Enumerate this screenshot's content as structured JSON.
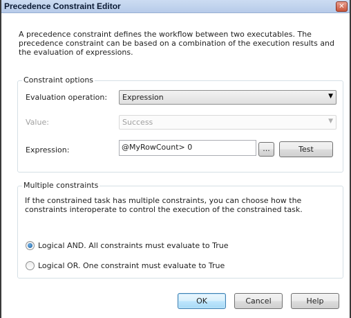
{
  "window": {
    "title": "Precedence Constraint Editor",
    "close_glyph": "✕"
  },
  "intro_text": "A precedence constraint defines the workflow between two executables. The precedence constraint can be based on a combination of the execution results and the evaluation of expressions.",
  "constraint_options": {
    "legend": "Constraint options",
    "evaluation_operation": {
      "label": "Evaluation operation:",
      "value": "Expression"
    },
    "value_field": {
      "label": "Value:",
      "value": "Success",
      "disabled": true
    },
    "expression": {
      "label": "Expression:",
      "value": "@MyRowCount> 0",
      "ellipsis_label": "...",
      "test_label": "Test"
    }
  },
  "multiple_constraints": {
    "legend": "Multiple constraints",
    "description": "If the constrained task has multiple constraints, you can choose how the constraints interoperate to control the execution of the constrained task.",
    "options": [
      {
        "label": "Logical AND. All constraints must evaluate to True",
        "checked": true
      },
      {
        "label": "Logical OR. One constraint must evaluate to True",
        "checked": false
      }
    ]
  },
  "buttons": {
    "ok": "OK",
    "cancel": "Cancel",
    "help": "Help"
  },
  "icons": {
    "dropdown": "chevron-down-icon",
    "close": "close-icon"
  },
  "colors": {
    "titlebar": "#b7cbe9",
    "close_button": "#c9563c",
    "focused_button": "#3c7fb1",
    "radio_checked": "#1a5f9f"
  }
}
